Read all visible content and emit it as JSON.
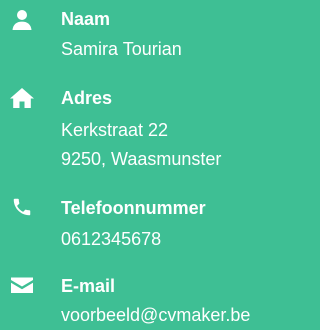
{
  "theme": {
    "background": "#3ebf94",
    "text_color": "#ffffff"
  },
  "contact": {
    "name": {
      "icon": "user-icon",
      "label": "Naam",
      "value": "Samira Tourian"
    },
    "address": {
      "icon": "home-icon",
      "label": "Adres",
      "line1": "Kerkstraat 22",
      "line2": "9250, Waasmunster"
    },
    "phone": {
      "icon": "phone-icon",
      "label": "Telefoonnummer",
      "value": "0612345678"
    },
    "email": {
      "icon": "envelope-icon",
      "label": "E-mail",
      "value": "voorbeeld@cvmaker.be"
    }
  }
}
